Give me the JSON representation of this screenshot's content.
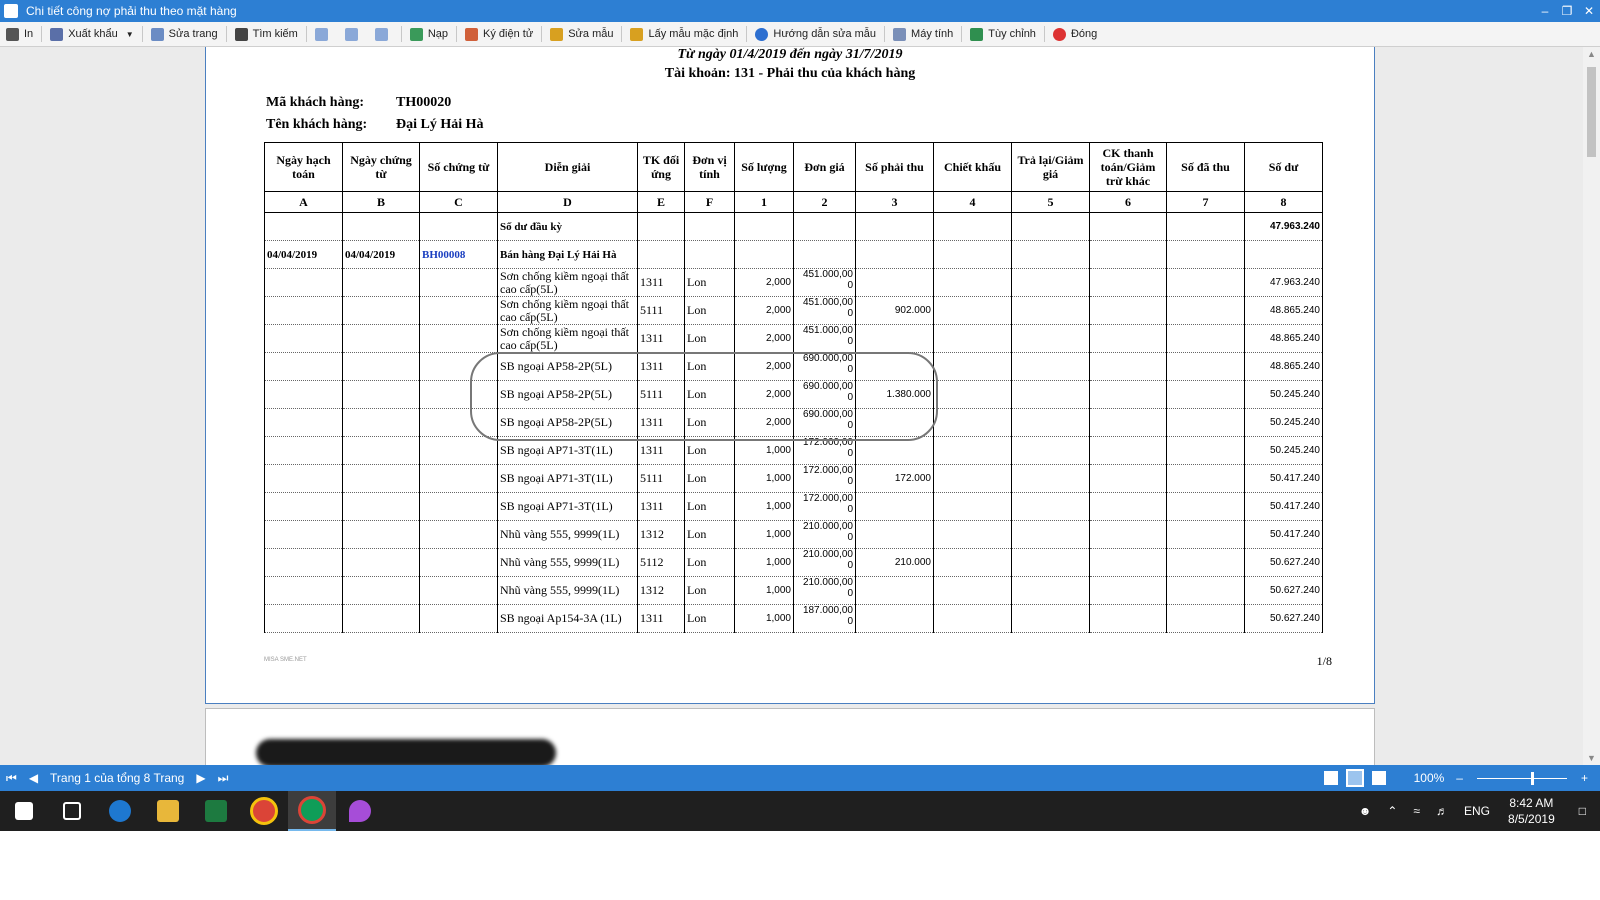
{
  "window": {
    "title": "Chi tiết công nợ phải thu theo mặt hàng"
  },
  "toolbar": {
    "print": "In",
    "export": "Xuất khẩu",
    "edit_page": "Sửa trang",
    "search": "Tìm kiếm",
    "load": "Nạp",
    "e_sign": "Ký điện tử",
    "edit_template": "Sửa mẫu",
    "default_template": "Lấy mẫu mặc định",
    "template_help": "Hướng dẫn sửa mẫu",
    "calculator": "Máy tính",
    "customize": "Tùy chỉnh",
    "close": "Đóng"
  },
  "report": {
    "period": "Từ ngày 01/4/2019 đến ngày 31/7/2019",
    "account": "Tài khoản: 131 - Phải thu của khách hàng",
    "customer_code_label": "Mã khách hàng:",
    "customer_code": "TH00020",
    "customer_name_label": "Tên khách hàng:",
    "customer_name": "Đại Lý Hải Hà",
    "headers": [
      "Ngày hạch toán",
      "Ngày chứng từ",
      "Số chứng từ",
      "Diễn giải",
      "TK đối ứng",
      "Đơn vị tính",
      "Số lượng",
      "Đơn giá",
      "Số phải thu",
      "Chiết khấu",
      "Trả lại/Giảm giá",
      "CK thanh toán/Giảm trừ khác",
      "Số đã thu",
      "Số dư"
    ],
    "letters": [
      "A",
      "B",
      "C",
      "D",
      "E",
      "F",
      "1",
      "2",
      "3",
      "4",
      "5",
      "6",
      "7",
      "8"
    ],
    "opening_label": "Số dư đầu kỳ",
    "opening_balance": "47.963.240",
    "header_row": {
      "date1": "04/04/2019",
      "date2": "04/04/2019",
      "doc": "BH00008",
      "desc": "Bán hàng Đại Lý Hải Hà"
    },
    "rows": [
      {
        "desc": "Sơn chống kiềm ngoại thất cao cấp(5L)",
        "acct": "1311",
        "unit": "Lon",
        "qty": "2,000",
        "price": "451.000,00 0",
        "receivable": "",
        "balance": "47.963.240"
      },
      {
        "desc": "Sơn chống kiềm ngoại thất cao cấp(5L)",
        "acct": "5111",
        "unit": "Lon",
        "qty": "2,000",
        "price": "451.000,00 0",
        "receivable": "902.000",
        "balance": "48.865.240"
      },
      {
        "desc": "Sơn chống kiềm ngoại thất cao cấp(5L)",
        "acct": "1311",
        "unit": "Lon",
        "qty": "2,000",
        "price": "451.000,00 0",
        "receivable": "",
        "balance": "48.865.240"
      },
      {
        "desc": "SB ngoại AP58-2P(5L)",
        "acct": "1311",
        "unit": "Lon",
        "qty": "2,000",
        "price": "690.000,00 0",
        "receivable": "",
        "balance": "48.865.240"
      },
      {
        "desc": "SB ngoại AP58-2P(5L)",
        "acct": "5111",
        "unit": "Lon",
        "qty": "2,000",
        "price": "690.000,00 0",
        "receivable": "1.380.000",
        "balance": "50.245.240"
      },
      {
        "desc": "SB ngoại AP58-2P(5L)",
        "acct": "1311",
        "unit": "Lon",
        "qty": "2,000",
        "price": "690.000,00 0",
        "receivable": "",
        "balance": "50.245.240"
      },
      {
        "desc": "SB ngoại AP71-3T(1L)",
        "acct": "1311",
        "unit": "Lon",
        "qty": "1,000",
        "price": "172.000,00 0",
        "receivable": "",
        "balance": "50.245.240"
      },
      {
        "desc": "SB ngoại AP71-3T(1L)",
        "acct": "5111",
        "unit": "Lon",
        "qty": "1,000",
        "price": "172.000,00 0",
        "receivable": "172.000",
        "balance": "50.417.240"
      },
      {
        "desc": "SB ngoại AP71-3T(1L)",
        "acct": "1311",
        "unit": "Lon",
        "qty": "1,000",
        "price": "172.000,00 0",
        "receivable": "",
        "balance": "50.417.240"
      },
      {
        "desc": "Nhũ vàng 555, 9999(1L)",
        "acct": "1312",
        "unit": "Lon",
        "qty": "1,000",
        "price": "210.000,00 0",
        "receivable": "",
        "balance": "50.417.240"
      },
      {
        "desc": "Nhũ vàng 555, 9999(1L)",
        "acct": "5112",
        "unit": "Lon",
        "qty": "1,000",
        "price": "210.000,00 0",
        "receivable": "210.000",
        "balance": "50.627.240"
      },
      {
        "desc": "Nhũ vàng 555, 9999(1L)",
        "acct": "1312",
        "unit": "Lon",
        "qty": "1,000",
        "price": "210.000,00 0",
        "receivable": "",
        "balance": "50.627.240"
      },
      {
        "desc": "SB ngoại Ap154-3A (1L)",
        "acct": "1311",
        "unit": "Lon",
        "qty": "1,000",
        "price": "187.000,00 0",
        "receivable": "",
        "balance": "50.627.240"
      }
    ],
    "footer_left": "MISA SME.NET",
    "page_num": "1/8"
  },
  "navbar": {
    "page_info": "Trang 1 của tổng 8 Trang",
    "zoom": "100%"
  },
  "taskbar": {
    "lang": "ENG",
    "time": "8:42 AM",
    "date": "8/5/2019"
  },
  "colors": {
    "titlebar": "#2d7fd3",
    "link": "#1b3fc0",
    "taskbar": "#1f1f1f"
  }
}
